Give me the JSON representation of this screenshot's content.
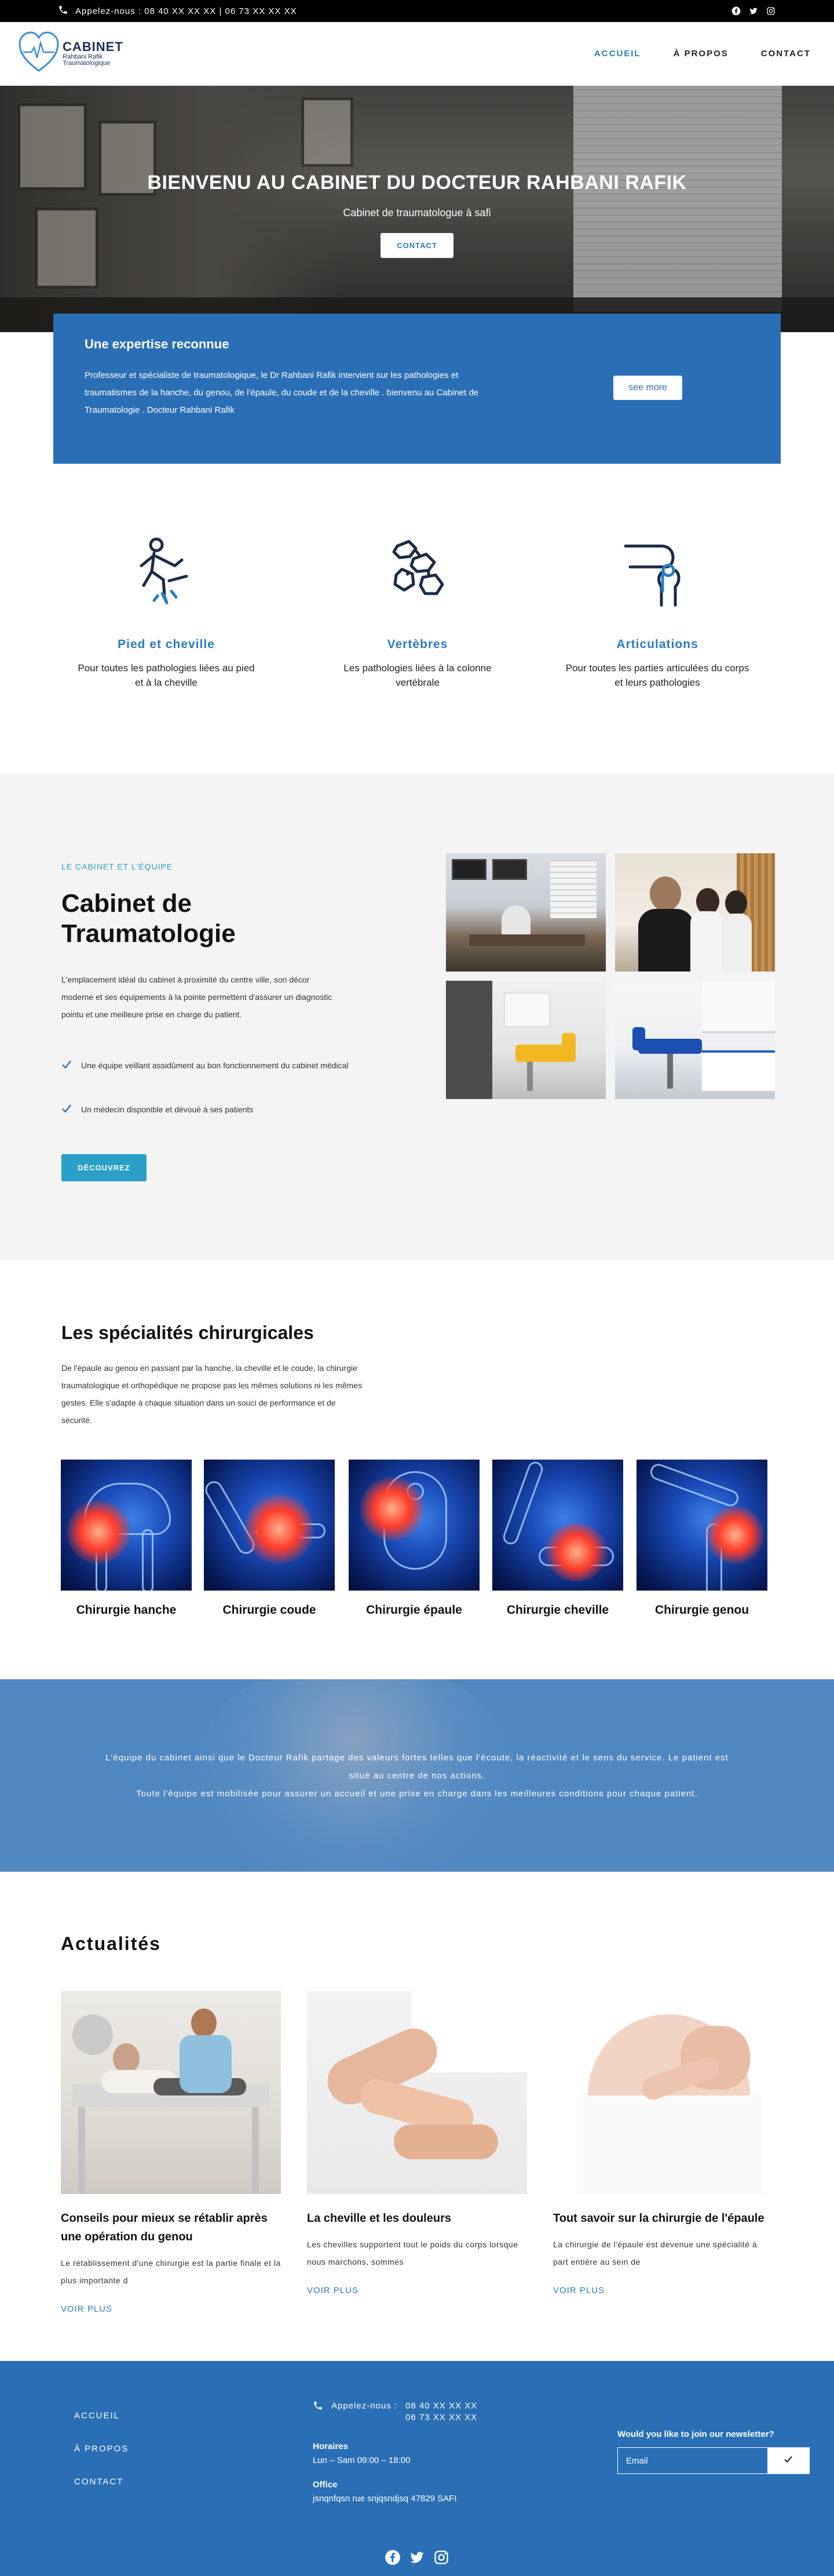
{
  "colors": {
    "accent": "#2a7bc3",
    "brand_blue": "#2a6fb6",
    "teal": "#2a9fc8",
    "topbar": "#000000"
  },
  "topbar": {
    "phone_text": "Appelez-nous : 08 40 XX XX XX | 06 73 XX XX XX",
    "social": [
      "facebook-icon",
      "twitter-icon",
      "instagram-icon"
    ]
  },
  "logo": {
    "line1": "CABINET",
    "line2": "Rahbani Rafik",
    "line3": "Traumatologique"
  },
  "nav": {
    "items": [
      "ACCUEIL",
      "À PROPOS",
      "CONTACT"
    ],
    "active": "ACCUEIL"
  },
  "hero": {
    "title": "BIENVENU AU CABINET DU DOCTEUR RAHBANI RAFIK",
    "subtitle": "Cabinet de  traumatologue à safi",
    "button": "CONTACT"
  },
  "expertise": {
    "title": "Une expertise reconnue",
    "text": "Professeur et spécialiste de  traumatologique, le Dr  Rahbani Rafik intervient sur les pathologies et traumatismes de la hanche, du genou, de l'épaule, du coude et de la cheville . bienvenu au Cabinet de Traumatologie . Docteur  Rahbani Rafik",
    "button": "see more"
  },
  "features": [
    {
      "icon": "sprained-ankle-icon",
      "title": "Pied et cheville",
      "text": "Pour toutes les pathologies liées au pied et à la cheville"
    },
    {
      "icon": "vertebrae-icon",
      "title": "Vertèbres",
      "text": "Les pathologies liées à la colonne vertébrale"
    },
    {
      "icon": "knee-joint-icon",
      "title": "Articulations",
      "text": "Pour toutes les parties articulées du corps et leurs pathologies"
    }
  ],
  "cabinet": {
    "kicker": "LE CABINET ET L'ÉQUIPE",
    "title": "Cabinet de Traumatologie",
    "text": "L'emplacement idéal du cabinet à proximité du centre ville, son décor moderne et ses équipements à la pointe permettent d'assurer un diagnostic pointu et une meilleure prise en charge du patient.",
    "checks": [
      "Une équipe veillant assidûment au bon fonctionnement du cabinet médical",
      "Un médecin disponible et dévoué à ses patients"
    ],
    "button": "DÉCOUVREZ"
  },
  "specs": {
    "title": "Les spécialités chirurgicales",
    "text": "De l'épaule au genou en passant par la hanche, la cheville et le coude, la chirurgie traumatologique et orthopédique ne propose pas les mêmes solutions ni les mêmes gestes. Elle s'adapte à chaque situation dans un souci de performance et de sécurité.",
    "items": [
      "Chirurgie hanche",
      "Chirurgie coude",
      "Chirurgie épaule",
      "Chirurgie cheville",
      "Chirurgie genou"
    ]
  },
  "band": {
    "line1": "L'équipe du cabinet ainsi que le Docteur Rafik partage des valeurs fortes telles que l'écoute, la réactivité et le sens du service. Le patient est",
    "line2": "situé au centre de nos actions.",
    "line3": "Toute l'équipe est mobilisée pour assurer un accueil et une prise en charge dans les meilleures conditions pour chaque patient."
  },
  "news": {
    "title": "Actualités",
    "cards": [
      {
        "title": "Conseils pour mieux se rétablir après une opération du genou",
        "text": "Le rétablissement d'une chirurgie est la partie finale et la plus importante d",
        "more": "VOIR PLUS"
      },
      {
        "title": "La cheville et les douleurs",
        "text": "Les chevilles supportent tout le poids du corps lorsque nous marchons, sommes",
        "more": "VOIR PLUS"
      },
      {
        "title": "Tout savoir sur la chirurgie de l'épaule",
        "text": "La chirurgie de l'épaule est devenue une spécialité à part entière au sein de",
        "more": "VOIR PLUS"
      }
    ]
  },
  "footer": {
    "links": [
      "ACCUEIL",
      "À PROPOS",
      "CONTACT"
    ],
    "phone_label": "Appelez-nous :",
    "phone1": "08 40 XX XX XX",
    "phone2": "06 73 XX XX XX",
    "hours_label": "Horaires",
    "hours": "Lun – Sam 09:00 – 18:00",
    "office_label": "Office",
    "office": "jsnqnfqsn rue snjqsndjsq 47829 SAFI",
    "newsletter_title": "Would you like to join our newsletter?",
    "email_placeholder": "Email"
  }
}
